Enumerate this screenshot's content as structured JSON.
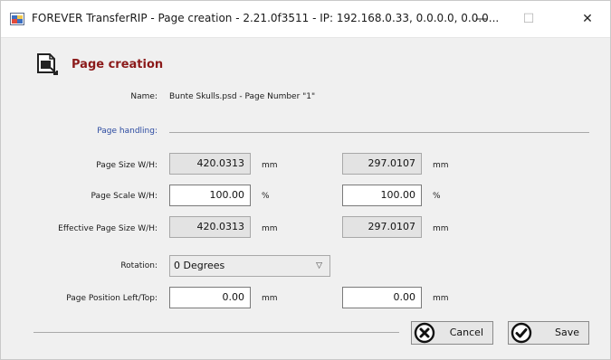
{
  "window": {
    "title": "FOREVER TransferRIP - Page creation - 2.21.0f3511 - IP: 192.168.0.33, 0.0.0.0, 0.0.0...",
    "minimize_glyph": "—",
    "maximize_glyph": "☐",
    "close_glyph": "✕"
  },
  "header": {
    "icon": "page-edit-icon",
    "title": "Page creation"
  },
  "form": {
    "name_label": "Name:",
    "name_value": "Bunte Skulls.psd - Page Number \"1\"",
    "section_label": "Page handling:",
    "page_size": {
      "label": "Page Size W/H:",
      "width": "420.0313",
      "width_unit": "mm",
      "height": "297.0107",
      "height_unit": "mm"
    },
    "page_scale": {
      "label": "Page Scale W/H:",
      "width": "100.00",
      "width_unit": "%",
      "height": "100.00",
      "height_unit": "%"
    },
    "effective_size": {
      "label": "Effective Page Size W/H:",
      "width": "420.0313",
      "width_unit": "mm",
      "height": "297.0107",
      "height_unit": "mm"
    },
    "rotation": {
      "label": "Rotation:",
      "value": "0 Degrees"
    },
    "page_position": {
      "label": "Page Position Left/Top:",
      "left": "0.00",
      "left_unit": "mm",
      "top": "0.00",
      "top_unit": "mm"
    }
  },
  "buttons": {
    "cancel_label": "Cancel",
    "cancel_icon": "x-circle-icon",
    "save_label": "Save",
    "save_icon": "check-circle-icon"
  },
  "colors": {
    "header_title": "#8b1a1a",
    "section_label": "#2b4aa0",
    "window_bg": "#f0f0f0"
  }
}
